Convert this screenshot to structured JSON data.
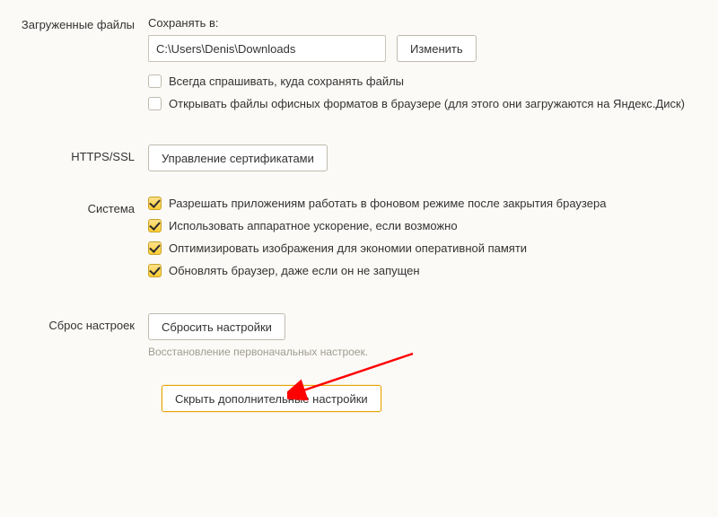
{
  "downloads": {
    "section_label": "Загруженные файлы",
    "save_in_label": "Сохранять в:",
    "path": "C:\\Users\\Denis\\Downloads",
    "change_button": "Изменить",
    "always_ask": "Всегда спрашивать, куда сохранять файлы",
    "open_office": "Открывать файлы офисных форматов в браузере (для этого они загружаются на Яндекс.Диск)"
  },
  "https": {
    "section_label": "HTTPS/SSL",
    "manage_certs": "Управление сертификатами"
  },
  "system": {
    "section_label": "Система",
    "bg_apps": "Разрешать приложениям работать в фоновом режиме после закрытия браузера",
    "hw_accel": "Использовать аппаратное ускорение, если возможно",
    "optimize_images": "Оптимизировать изображения для экономии оперативной памяти",
    "update_browser": "Обновлять браузер, даже если он не запущен"
  },
  "reset": {
    "section_label": "Сброс настроек",
    "reset_button": "Сбросить настройки",
    "desc": "Восстановление первоначальных настроек."
  },
  "hide_advanced": "Скрыть дополнительные настройки"
}
